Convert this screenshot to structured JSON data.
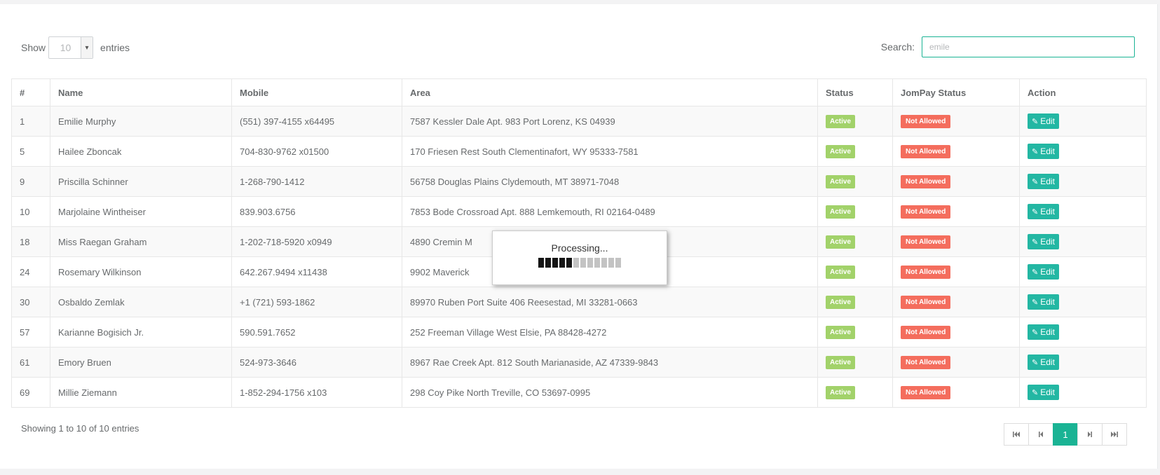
{
  "length_menu": {
    "show_label": "Show",
    "selected": "10",
    "entries_label": "entries"
  },
  "search": {
    "label": "Search:",
    "value": "emile"
  },
  "table": {
    "headers": [
      "#",
      "Name",
      "Mobile",
      "Area",
      "Status",
      "JomPay Status",
      "Action"
    ],
    "rows": [
      {
        "id": "1",
        "name": "Emilie Murphy",
        "mobile": "(551) 397-4155 x64495",
        "area": "7587 Kessler Dale Apt. 983 Port Lorenz, KS 04939",
        "status": "Active",
        "jompay": "Not Allowed",
        "action": "Edit"
      },
      {
        "id": "5",
        "name": "Hailee Zboncak",
        "mobile": "704-830-9762 x01500",
        "area": "170 Friesen Rest South Clementinafort, WY 95333-7581",
        "status": "Active",
        "jompay": "Not Allowed",
        "action": "Edit"
      },
      {
        "id": "9",
        "name": "Priscilla Schinner",
        "mobile": "1-268-790-1412",
        "area": "56758 Douglas Plains Clydemouth, MT 38971-7048",
        "status": "Active",
        "jompay": "Not Allowed",
        "action": "Edit"
      },
      {
        "id": "10",
        "name": "Marjolaine Wintheiser",
        "mobile": "839.903.6756",
        "area": "7853 Bode Crossroad Apt. 888 Lemkemouth, RI 02164-0489",
        "status": "Active",
        "jompay": "Not Allowed",
        "action": "Edit"
      },
      {
        "id": "18",
        "name": "Miss Raegan Graham",
        "mobile": "1-202-718-5920 x0949",
        "area": "4890 Cremin M",
        "status": "Active",
        "jompay": "Not Allowed",
        "action": "Edit"
      },
      {
        "id": "24",
        "name": "Rosemary Wilkinson",
        "mobile": "642.267.9494 x11438",
        "area": "9902 Maverick",
        "status": "Active",
        "jompay": "Not Allowed",
        "action": "Edit"
      },
      {
        "id": "30",
        "name": "Osbaldo Zemlak",
        "mobile": "+1 (721) 593-1862",
        "area": "89970 Ruben Port Suite 406 Reesestad, MI 33281-0663",
        "status": "Active",
        "jompay": "Not Allowed",
        "action": "Edit"
      },
      {
        "id": "57",
        "name": "Karianne Bogisich Jr.",
        "mobile": "590.591.7652",
        "area": "252 Freeman Village West Elsie, PA 88428-4272",
        "status": "Active",
        "jompay": "Not Allowed",
        "action": "Edit"
      },
      {
        "id": "61",
        "name": "Emory Bruen",
        "mobile": "524-973-3646",
        "area": "8967 Rae Creek Apt. 812 South Marianaside, AZ 47339-9843",
        "status": "Active",
        "jompay": "Not Allowed",
        "action": "Edit"
      },
      {
        "id": "69",
        "name": "Millie Ziemann",
        "mobile": "1-852-294-1756 x103",
        "area": "298 Coy Pike North Treville, CO 53697-0995",
        "status": "Active",
        "jompay": "Not Allowed",
        "action": "Edit"
      }
    ]
  },
  "info": "Showing 1 to 10 of 10 entries",
  "pagination": {
    "current_page": "1",
    "icons": [
      "first-page-icon",
      "previous-page-icon",
      "next-page-icon",
      "last-page-icon"
    ]
  },
  "processing": {
    "text": "Processing...",
    "progress": 0.42
  },
  "colors": {
    "accent": "#1ab394",
    "status_active": "#a2d26a",
    "status_not_allowed": "#f46d5d",
    "edit_button": "#23b7a3"
  },
  "icons": {
    "edit": "edit-icon",
    "select_arrow": "chevron-down-icon"
  }
}
